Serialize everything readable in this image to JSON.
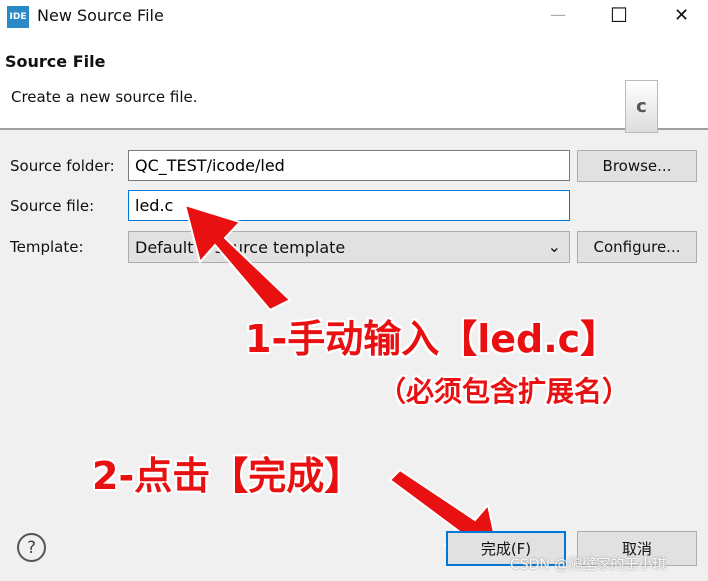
{
  "window": {
    "title": "New Source File",
    "logo_text": "IDE",
    "minimize": "—",
    "maximize": "☐",
    "close": "✕"
  },
  "header": {
    "title": "Source File",
    "description": "Create a new source file.",
    "icon": "c-source-file-icon",
    "icon_letter": "c"
  },
  "form": {
    "source_folder": {
      "label": "Source folder:",
      "value": "QC_TEST/icode/led",
      "button": "Browse..."
    },
    "source_file": {
      "label": "Source file:",
      "value": "led.c"
    },
    "template": {
      "label": "Template:",
      "value": "Default C source template",
      "button": "Configure..."
    }
  },
  "annotations": {
    "step1": "1-手动输入【led.c】",
    "step1_note": "（必须包含扩展名）",
    "step2": "2-点击【完成】",
    "color": "#e81010"
  },
  "footer": {
    "help": "?",
    "finish": "完成(F)",
    "cancel": "取消"
  },
  "watermark": "CSDN @隔壁家的王小琪"
}
